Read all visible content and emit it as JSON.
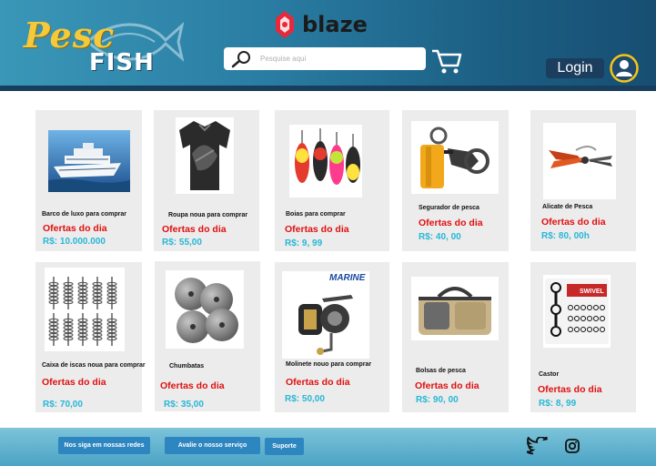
{
  "header": {
    "logo_top": "Pesc",
    "logo_bottom": "FISH",
    "brand_name": "blaze",
    "search_placeholder": "Pesquise aqui",
    "login_label": "Login"
  },
  "products": [
    {
      "name": "Barco de luxo para comprar",
      "offer": "Ofertas do dia",
      "price": "R$: 10.000.000",
      "icon": "cruise-ship"
    },
    {
      "name": "Roupa noua para comprar",
      "offer": "Ofertas do dia",
      "price": "R$: 55,00",
      "icon": "fishing-shirt"
    },
    {
      "name": "Boias para comprar",
      "offer": "Ofertas do dia",
      "price": "R$: 9, 99",
      "icon": "fishing-floats"
    },
    {
      "name": "Segurador de pesca",
      "offer": "Ofertas do dia",
      "price": "R$: 40, 00",
      "icon": "fish-gripper"
    },
    {
      "name": "Alicate de Pesca",
      "offer": "Ofertas do dia",
      "price": "R$: 80, 00h",
      "icon": "fishing-pliers"
    },
    {
      "name": "Caixa de iscas noua para comprar",
      "offer": "Ofertas do dia",
      "price": "R$: 70,00",
      "icon": "bait-springs"
    },
    {
      "name": "Chumbatas",
      "offer": "Ofertas do dia",
      "price": "R$: 35,00",
      "icon": "lead-sinkers"
    },
    {
      "name": "Molinete nouo para comprar",
      "offer": "Ofertas do dia",
      "price": "R$: 50,00",
      "icon": "fishing-reel",
      "badge": "MARINE"
    },
    {
      "name": "Bolsas de pesca",
      "offer": "Ofertas do dia",
      "price": "R$: 90, 00",
      "icon": "fishing-bag"
    },
    {
      "name": "Castor",
      "offer": "Ofertas do dia",
      "price": "R$: 8, 99",
      "icon": "swivels",
      "badge": "SWIVEL"
    }
  ],
  "footer": {
    "follow_label": "Nos siga em nossas redes",
    "rate_label": "Avalie o nosso serviço",
    "support_label": "Suporte"
  },
  "colors": {
    "header_start": "#3a97b8",
    "header_end": "#174e72",
    "offer_red": "#e01010",
    "price_cyan": "#27b7d6",
    "login_bg": "#1b3d5e",
    "footer_button": "#2e86c1",
    "avatar_ring": "#f5c518"
  }
}
